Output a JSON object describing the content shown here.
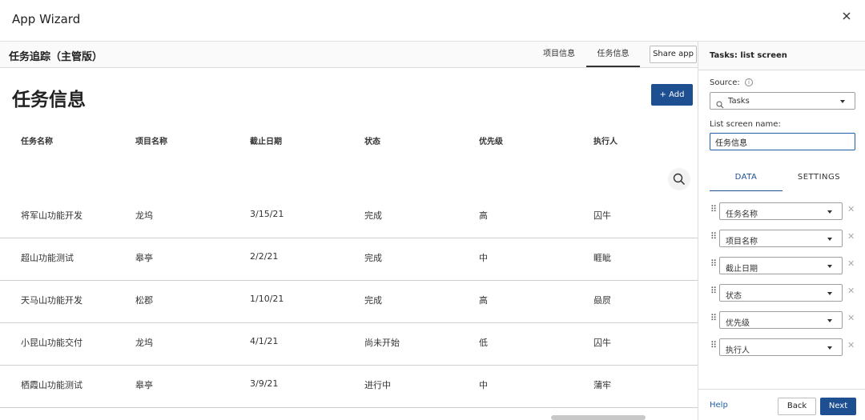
{
  "window": {
    "title": "App Wizard"
  },
  "app": {
    "name": "任务追踪（主管版）",
    "nav_tabs": [
      {
        "label": "项目信息",
        "active": false
      },
      {
        "label": "任务信息",
        "active": true
      }
    ],
    "share_label": "Share app"
  },
  "page": {
    "title": "任务信息",
    "add_label": "+ Add",
    "columns": [
      "任务名称",
      "项目名称",
      "截止日期",
      "状态",
      "优先级",
      "执行人"
    ],
    "rows": [
      [
        "将军山功能开发",
        "龙坞",
        "3/15/21",
        "完成",
        "高",
        "囚牛"
      ],
      [
        "超山功能测试",
        "皋亭",
        "2/2/21",
        "完成",
        "中",
        "睚眦"
      ],
      [
        "天马山功能开发",
        "松郡",
        "1/10/21",
        "完成",
        "高",
        "赑屃"
      ],
      [
        "小昆山功能交付",
        "龙坞",
        "4/1/21",
        "尚未开始",
        "低",
        "囚牛"
      ],
      [
        "栖霞山功能测试",
        "皋亭",
        "3/9/21",
        "进行中",
        "中",
        "蒲牢"
      ]
    ]
  },
  "panel": {
    "title": "Tasks: list screen",
    "source_label": "Source:",
    "source_value": "Tasks",
    "name_label": "List screen name:",
    "name_value": "任务信息",
    "tabs": [
      {
        "label": "DATA",
        "active": true
      },
      {
        "label": "SETTINGS",
        "active": false
      }
    ],
    "fields": [
      "任务名称",
      "项目名称",
      "截止日期",
      "状态",
      "优先级",
      "执行人"
    ],
    "help_label": "Help",
    "back_label": "Back",
    "next_label": "Next"
  },
  "colors": {
    "accent": "#1d4f91",
    "link": "#1d5ea8"
  },
  "icons": [
    "close-icon",
    "search-icon",
    "info-icon",
    "drag-handle-icon",
    "remove-icon",
    "chevron-down-icon"
  ]
}
